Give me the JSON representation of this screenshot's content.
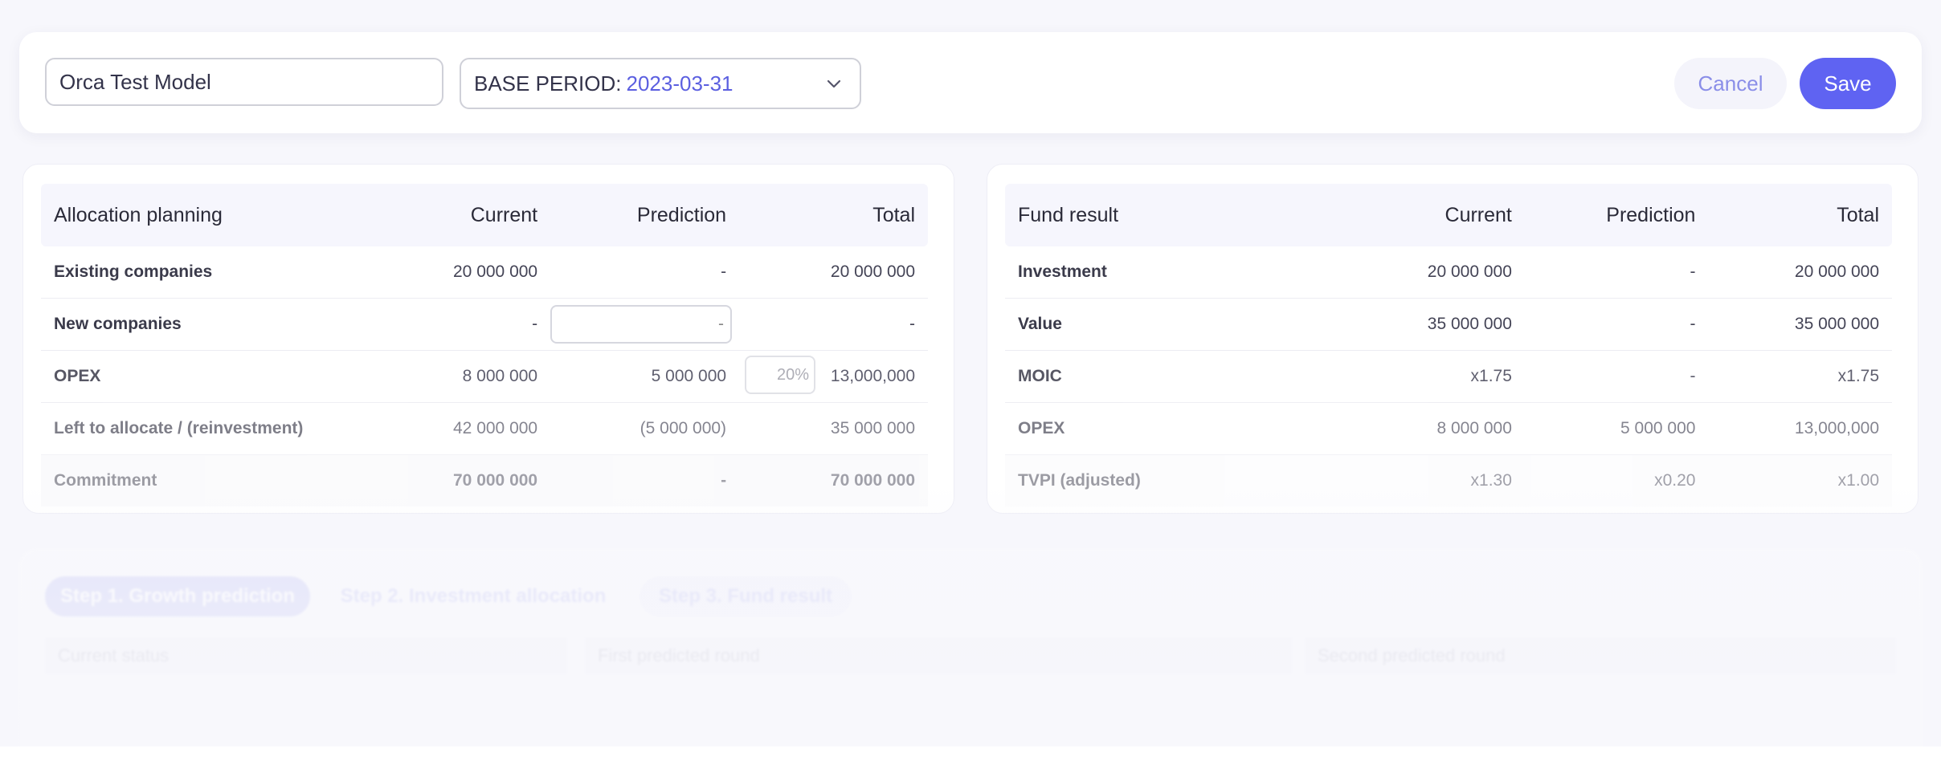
{
  "header": {
    "model_name": "Orca Test Model",
    "base_period_label": "BASE PERIOD:",
    "base_period_value": "2023-03-31",
    "cancel_label": "Cancel",
    "save_label": "Save"
  },
  "allocation": {
    "headers": [
      "Allocation planning",
      "Current",
      "Prediction",
      "Total"
    ],
    "rows": [
      [
        "Existing companies",
        "20 000 000",
        "-",
        "20 000 000"
      ],
      [
        "New companies",
        "-",
        "-",
        "-"
      ],
      [
        "OPEX",
        "8 000 000",
        "5 000 000",
        "13,000,000"
      ],
      [
        "Left to allocate / (reinvestment)",
        "42 000 000",
        "(5 000 000)",
        "35 000 000"
      ],
      [
        "Commitment",
        "70 000 000",
        "-",
        "70 000 000"
      ]
    ],
    "opex_pct": "20%"
  },
  "fund": {
    "headers": [
      "Fund result",
      "Current",
      "Prediction",
      "Total"
    ],
    "rows": [
      [
        "Investment",
        "20 000 000",
        "-",
        "20 000 000"
      ],
      [
        "Value",
        "35 000 000",
        "-",
        "35 000 000"
      ],
      [
        "MOIC",
        "x1.75",
        "-",
        "x1.75"
      ],
      [
        "OPEX",
        "8 000 000",
        "5 000 000",
        "13,000,000"
      ],
      [
        "TVPI (adjusted)",
        "x1.30",
        "x0.20",
        "x1.00"
      ]
    ]
  },
  "steps": {
    "step1": "Step 1. Growth prediction",
    "step2": "Step 2. Investment allocation",
    "step3": "Step 3. Fund result"
  },
  "sections": {
    "current": "Current status",
    "first": "First predicted round",
    "second": "Second predicted round"
  },
  "colors": {
    "accent": "#5f63f2",
    "accent_text": "#5b5fe0",
    "cancel_bg": "#f4f4fb"
  }
}
